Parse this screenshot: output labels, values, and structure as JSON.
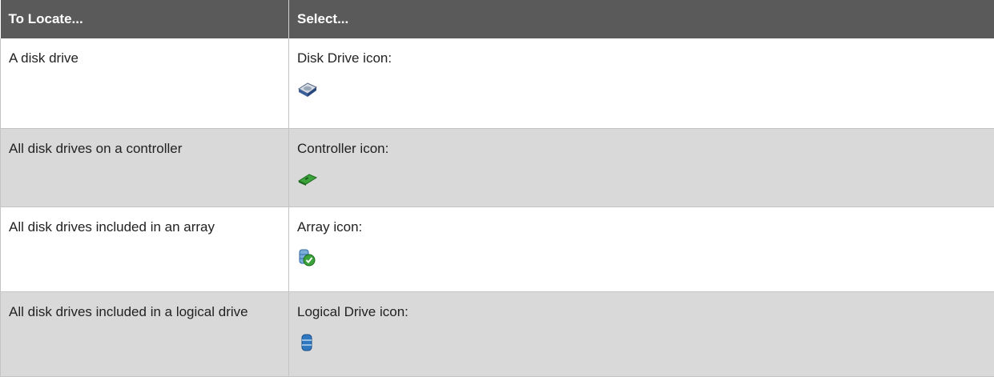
{
  "header": {
    "col1": "To Locate...",
    "col2": "Select..."
  },
  "rows": [
    {
      "locate": "A disk drive",
      "select": "Disk Drive icon:",
      "icon": "disk-drive-icon"
    },
    {
      "locate": "All disk drives on a controller",
      "select": "Controller icon:",
      "icon": "controller-icon"
    },
    {
      "locate": "All disk drives included in an array",
      "select": "Array icon:",
      "icon": "array-icon"
    },
    {
      "locate": "All disk drives included in a logical drive",
      "select": "Logical Drive icon:",
      "icon": "logical-drive-icon"
    }
  ],
  "colors": {
    "header_bg": "#5a5a5a",
    "stripe_bg": "#d9d9d9",
    "green": "#3aa33a",
    "blue": "#2f78c0"
  }
}
